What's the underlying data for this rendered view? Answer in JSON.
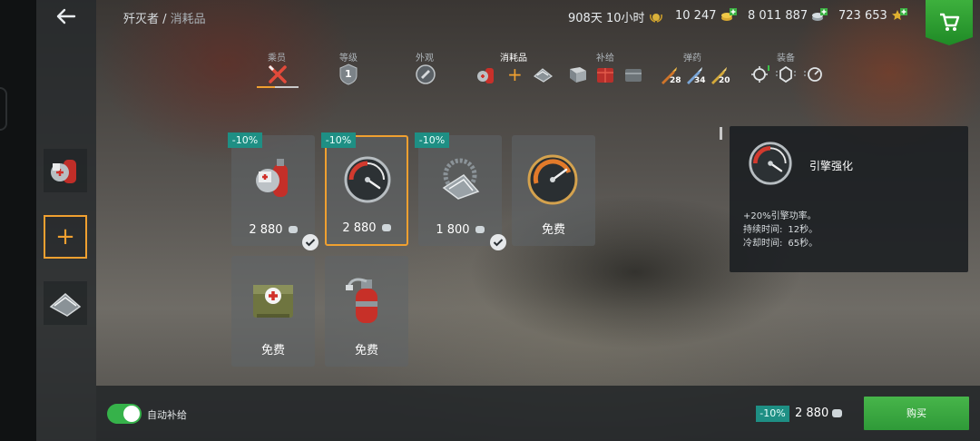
{
  "breadcrumb": {
    "vehicle": "歼灭者",
    "separator": " / ",
    "section": "消耗品"
  },
  "top_currency": {
    "premium_time": "908天 10小时",
    "gold": "10 247",
    "credits": "8 011 887",
    "free_xp": "723 653"
  },
  "icons": {
    "back": "back-arrow-icon",
    "shop": "shopping-cart-icon",
    "credits": "silver-coins-icon"
  },
  "tabs": [
    {
      "label": "乘员"
    },
    {
      "label": "等级",
      "level": "1"
    },
    {
      "label": "外观"
    },
    {
      "label": "消耗品"
    },
    {
      "label": "补给"
    },
    {
      "label": "弹药",
      "counts": [
        "28",
        "34",
        "20"
      ]
    },
    {
      "label": "装备"
    }
  ],
  "items": [
    {
      "discount": "-10%",
      "price": "2 880",
      "owned": true,
      "icon": "repair-kit-icon"
    },
    {
      "discount": "-10%",
      "price": "2 880",
      "owned": false,
      "selected": true,
      "icon": "engine-gauge-icon"
    },
    {
      "discount": "-10%",
      "price": "1 800",
      "owned": true,
      "icon": "track-drill-icon"
    },
    {
      "price": "免费",
      "icon": "orange-gauge-icon"
    },
    {
      "price": "免费",
      "icon": "medkit-icon"
    },
    {
      "price": "免费",
      "icon": "fire-extinguisher-icon"
    }
  ],
  "info": {
    "title": "引擎强化",
    "effect": "+20%引擎功率。",
    "duration_label": "持续时间:",
    "duration_value": "12秒。",
    "cooldown_label": "冷却时间:",
    "cooldown_value": "65秒。"
  },
  "bottom": {
    "auto_resupply_label": "自动补给",
    "auto_resupply_on": true,
    "discount": "-10%",
    "price": "2 880",
    "buy_label": "购买"
  },
  "colors": {
    "accent_orange": "#f0a030",
    "discount_teal": "#1e8f84",
    "buy_green": "#3aa840",
    "toggle_green": "#36b24a"
  }
}
